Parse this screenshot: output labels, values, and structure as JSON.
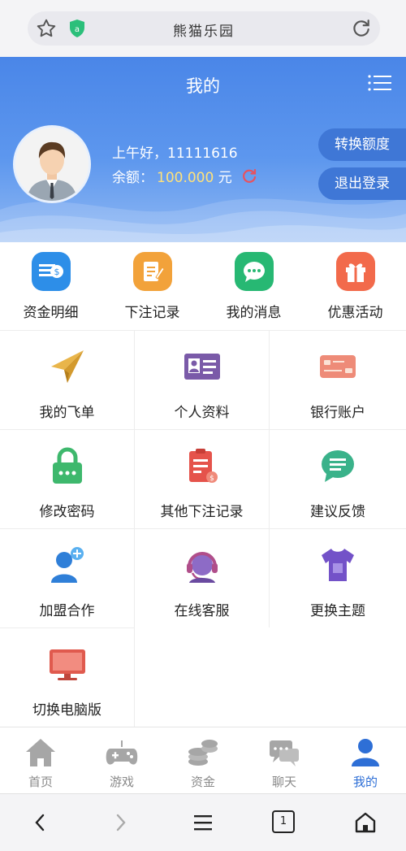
{
  "browser": {
    "site_title": "熊猫乐园",
    "shield_glyph": "a"
  },
  "header": {
    "title": "我的"
  },
  "user": {
    "greeting": "上午好，11111616",
    "balance_label": "余额：",
    "balance_amount": "100.000",
    "balance_unit": "元",
    "transfer_label": "转换额度",
    "logout_label": "退出登录"
  },
  "quick": [
    {
      "label": "资金明细",
      "icon": "fund-icon",
      "color": "#2d8ee8"
    },
    {
      "label": "下注记录",
      "icon": "bet-record-icon",
      "color": "#f2a23a"
    },
    {
      "label": "我的消息",
      "icon": "message-icon",
      "color": "#27b873"
    },
    {
      "label": "优惠活动",
      "icon": "gift-icon",
      "color": "#f26a4b"
    }
  ],
  "grid": [
    {
      "label": "我的飞单",
      "icon": "paper-plane-icon"
    },
    {
      "label": "个人资料",
      "icon": "id-card-icon"
    },
    {
      "label": "银行账户",
      "icon": "bank-card-icon"
    },
    {
      "label": "修改密码",
      "icon": "lock-icon"
    },
    {
      "label": "其他下注记录",
      "icon": "clipboard-icon"
    },
    {
      "label": "建议反馈",
      "icon": "feedback-icon"
    },
    {
      "label": "加盟合作",
      "icon": "add-user-icon"
    },
    {
      "label": "在线客服",
      "icon": "headset-icon"
    },
    {
      "label": "更换主题",
      "icon": "tshirt-icon"
    },
    {
      "label": "切换电脑版",
      "icon": "monitor-icon"
    }
  ],
  "tabs": [
    {
      "label": "首页",
      "icon": "home-icon"
    },
    {
      "label": "游戏",
      "icon": "gamepad-icon"
    },
    {
      "label": "资金",
      "icon": "coins-icon"
    },
    {
      "label": "聊天",
      "icon": "chat-icon"
    },
    {
      "label": "我的",
      "icon": "user-icon",
      "active": true
    }
  ],
  "browser_nav": {
    "tab_count": "1"
  },
  "colors": {
    "accent": "#2e6fd6",
    "banner": "#4a86e8",
    "amount": "#ffe27a"
  }
}
